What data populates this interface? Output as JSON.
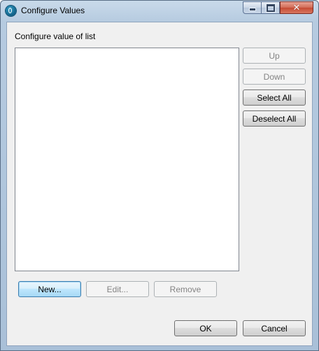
{
  "window": {
    "title": "Configure Values",
    "controls": {
      "minimize": "minimize-icon",
      "maximize": "maximize-icon",
      "close": "close-icon",
      "close_glyph": "✕"
    }
  },
  "content": {
    "label": "Configure value of list",
    "list_items": []
  },
  "side_buttons": {
    "up": "Up",
    "down": "Down",
    "select_all": "Select All",
    "deselect_all": "Deselect All"
  },
  "bottom_buttons": {
    "new": "New...",
    "edit": "Edit...",
    "remove": "Remove"
  },
  "footer": {
    "ok": "OK",
    "cancel": "Cancel"
  },
  "colors": {
    "frame": "#b6cbe0",
    "client_bg": "#f0f0f0",
    "default_button": "#bee6fd",
    "close_button": "#c54a33"
  }
}
